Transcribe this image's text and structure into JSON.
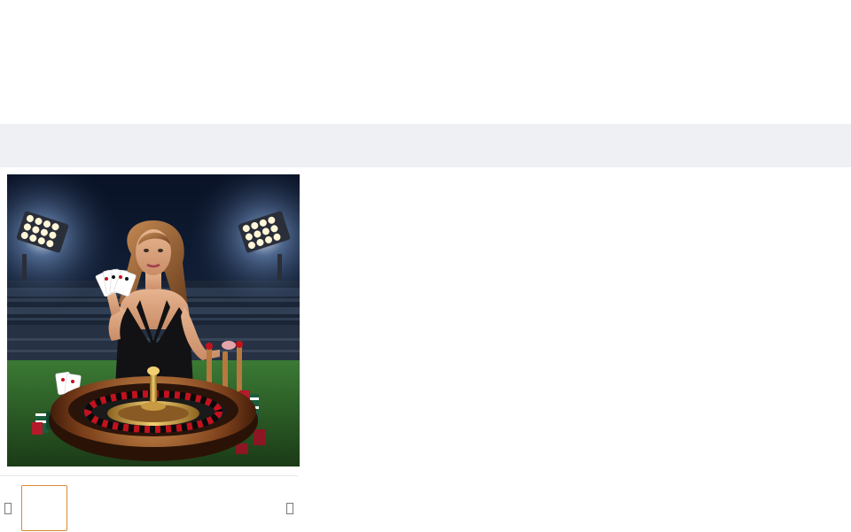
{
  "gallery": {
    "main_image": {
      "alt": "",
      "icon": "product-image"
    },
    "thumbnails": [
      {
        "selected": true,
        "accent_color": "#d98a33"
      }
    ],
    "nav": {
      "prev_icon": "chevron-left-icon",
      "next_icon": "chevron-right-icon"
    }
  },
  "colors": {
    "header_bar": "#eff0f3",
    "thumb_border": "#d98a33"
  }
}
